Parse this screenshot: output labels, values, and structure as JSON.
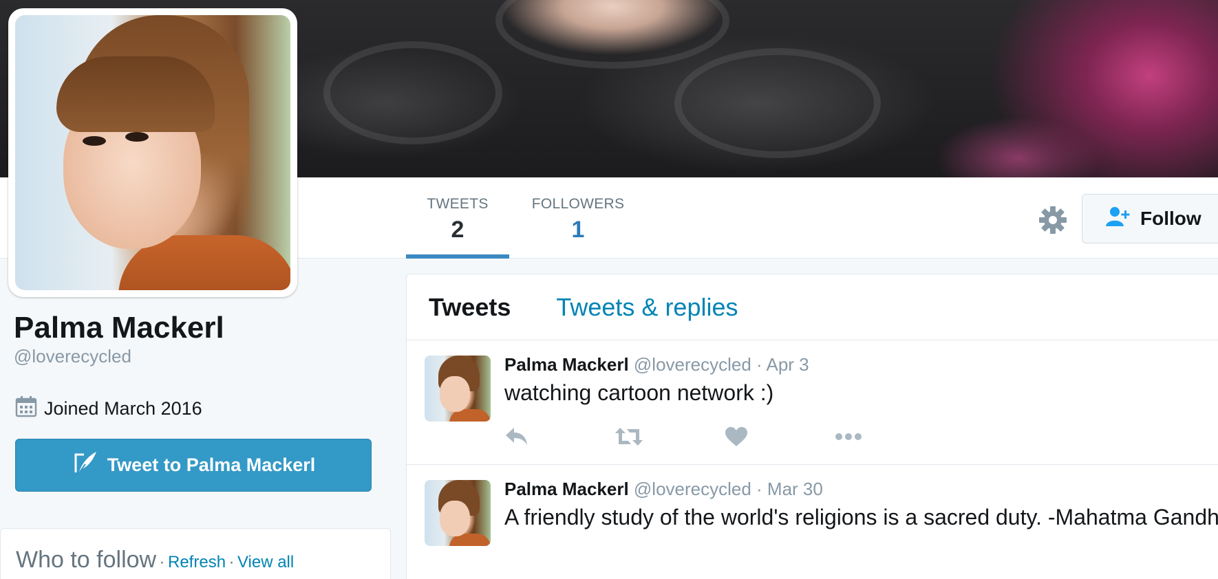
{
  "profile": {
    "name": "Palma Mackerl",
    "handle": "@loverecycled",
    "joined": "Joined March 2016",
    "tweet_to_label": "Tweet to Palma Mackerl"
  },
  "nav": {
    "tweets_label": "TWEETS",
    "tweets_count": "2",
    "followers_label": "FOLLOWERS",
    "followers_count": "1",
    "follow_label": "Follow"
  },
  "timeline": {
    "tabs": [
      {
        "label": "Tweets",
        "active": true
      },
      {
        "label": "Tweets & replies",
        "active": false
      }
    ],
    "tweets": [
      {
        "name": "Palma Mackerl",
        "handle": "@loverecycled",
        "date": "· Apr 3",
        "text": "watching cartoon network :)"
      },
      {
        "name": "Palma Mackerl",
        "handle": "@loverecycled",
        "date": "· Mar 30",
        "text": "A friendly study of the world's religions is a sacred duty. -Mahatma Gandhi"
      }
    ]
  },
  "who_to_follow": {
    "title": "Who to follow",
    "separator": "·",
    "refresh": "Refresh",
    "view_all": "View all"
  },
  "icons": {
    "settings": "gear-icon",
    "follow": "add-user-icon",
    "joined": "calendar-icon",
    "tweet_to": "quill-icon",
    "reply": "reply-icon",
    "retweet": "retweet-icon",
    "like": "heart-icon",
    "more": "more-icon"
  },
  "colors": {
    "link": "#0084b4",
    "accent": "#3b88c3",
    "button": "#3399c6",
    "muted": "#8899a6",
    "icon": "#aab8c2"
  }
}
